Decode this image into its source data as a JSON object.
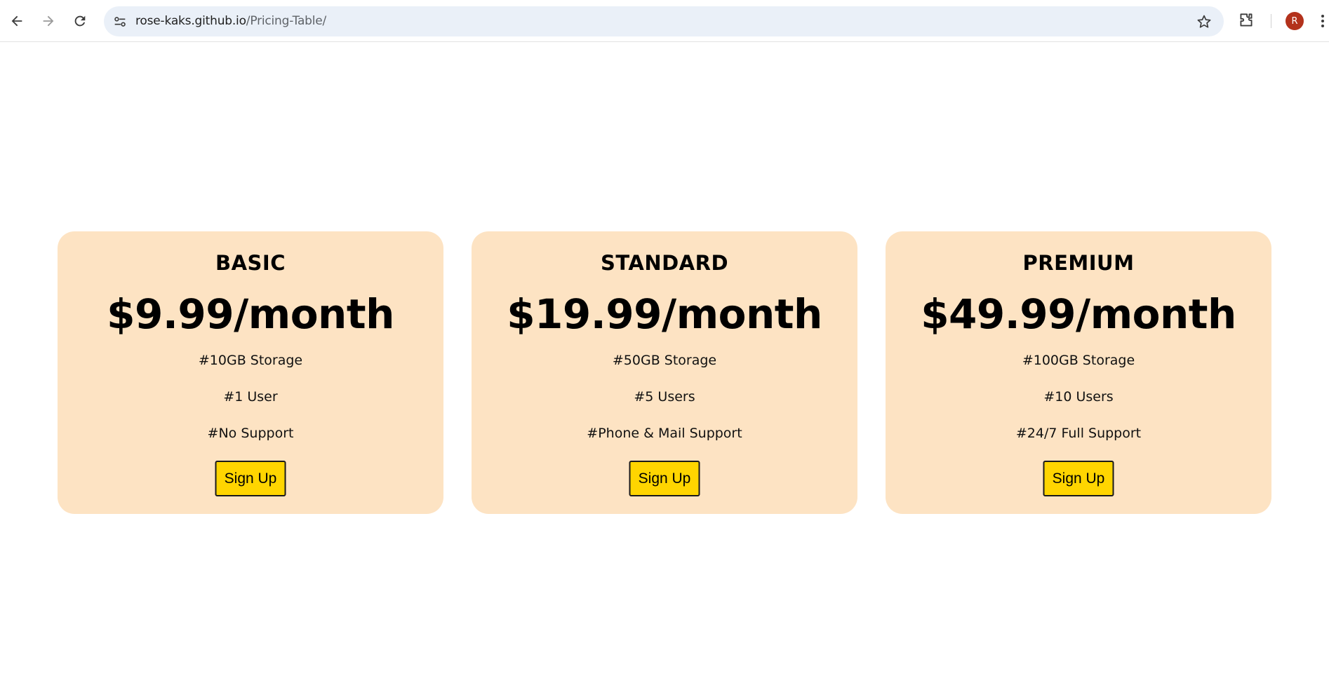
{
  "browser": {
    "url_host": "rose-kaks.github.io",
    "url_path": "/Pricing-Table/",
    "profile_initial": "R",
    "icons": [
      "back-arrow-icon",
      "forward-arrow-icon",
      "reload-icon",
      "site-settings-icon",
      "star-icon",
      "extensions-icon",
      "kebab-menu-icon"
    ]
  },
  "colors": {
    "card_background": "#fde3c3",
    "button_background": "#ffd500",
    "avatar": "#b3321c",
    "omnibox": "#eaf0f8"
  },
  "plans": [
    {
      "name": "BASIC",
      "price": "$9.99/month",
      "features": [
        "#10GB Storage",
        "#1 User",
        "#No Support"
      ],
      "button": "Sign Up"
    },
    {
      "name": "STANDARD",
      "price": "$19.99/month",
      "features": [
        "#50GB Storage",
        "#5 Users",
        "#Phone & Mail Support"
      ],
      "button": "Sign Up"
    },
    {
      "name": "PREMIUM",
      "price": "$49.99/month",
      "features": [
        "#100GB Storage",
        "#10 Users",
        "#24/7 Full Support"
      ],
      "button": "Sign Up"
    }
  ]
}
